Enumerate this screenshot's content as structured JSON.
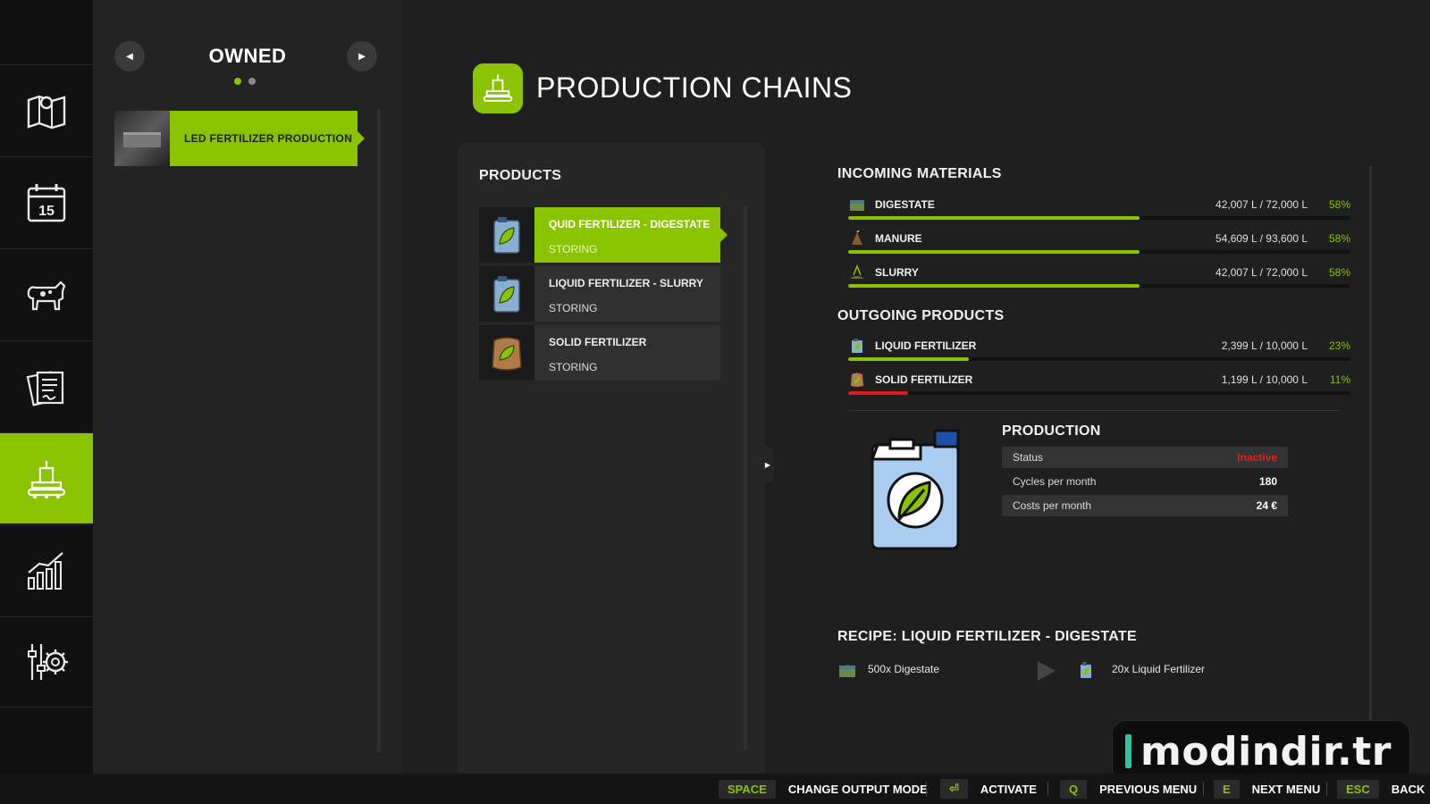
{
  "sidebar": {
    "items": [
      {
        "icon": "map-icon"
      },
      {
        "icon": "calendar-icon",
        "day": "15"
      },
      {
        "icon": "cow-icon"
      },
      {
        "icon": "contracts-icon"
      },
      {
        "icon": "production-icon",
        "active": true
      },
      {
        "icon": "statistics-icon"
      },
      {
        "icon": "settings-icon"
      }
    ]
  },
  "owned": {
    "title": "OWNED",
    "prev_label": "◀",
    "next_label": "▶",
    "page_count": 2,
    "current_page": 1,
    "items": [
      {
        "label": "LED FERTILIZER PRODUCTION"
      }
    ]
  },
  "header": {
    "title": "PRODUCTION CHAINS"
  },
  "products": {
    "title": "PRODUCTS",
    "items": [
      {
        "name": "QUID FERTILIZER - DIGESTATE",
        "status": "STORING",
        "icon": "liquid-fertilizer-icon",
        "active": true
      },
      {
        "name": "LIQUID FERTILIZER - SLURRY",
        "status": "STORING",
        "icon": "liquid-fertilizer-icon"
      },
      {
        "name": "SOLID FERTILIZER",
        "status": "STORING",
        "icon": "solid-fertilizer-icon"
      }
    ]
  },
  "incoming": {
    "title": "INCOMING MATERIALS",
    "items": [
      {
        "name": "DIGESTATE",
        "amount": "42,007 L / 72,000 L",
        "percent": "58%",
        "fill": 0.58,
        "icon": "digestate-icon"
      },
      {
        "name": "MANURE",
        "amount": "54,609 L / 93,600 L",
        "percent": "58%",
        "fill": 0.58,
        "icon": "manure-icon"
      },
      {
        "name": "SLURRY",
        "amount": "42,007 L / 72,000 L",
        "percent": "58%",
        "fill": 0.58,
        "icon": "slurry-icon"
      }
    ]
  },
  "outgoing": {
    "title": "OUTGOING PRODUCTS",
    "items": [
      {
        "name": "LIQUID FERTILIZER",
        "amount": "2,399 L / 10,000 L",
        "percent": "23%",
        "fill": 0.24,
        "icon": "liquid-fertilizer-small-icon"
      },
      {
        "name": "SOLID FERTILIZER",
        "amount": "1,199 L / 10,000 L",
        "percent": "11%",
        "fill": 0.12,
        "icon": "solid-fertilizer-small-icon"
      }
    ]
  },
  "production": {
    "title": "PRODUCTION",
    "rows": [
      {
        "label": "Status",
        "value": "Inactive"
      },
      {
        "label": "Cycles per month",
        "value": "180"
      },
      {
        "label": "Costs per month",
        "value": "24 €"
      }
    ]
  },
  "recipe": {
    "title": "RECIPE: LIQUID FERTILIZER - DIGESTATE",
    "input": "500x Digestate",
    "output": "20x Liquid Fertilizer"
  },
  "footer": {
    "actions": [
      {
        "key": "SPACE",
        "label": "CHANGE OUTPUT MODE"
      },
      {
        "key": "⏎",
        "label": "ACTIVATE"
      },
      {
        "key": "Q",
        "label": "PREVIOUS MENU"
      },
      {
        "key": "E",
        "label": "NEXT MENU"
      },
      {
        "key": "ESC",
        "label": "BACK"
      }
    ]
  },
  "watermark": "modindir.tr",
  "colors": {
    "accent": "#8ac400",
    "bar_green": "#8ac400",
    "bar_red": "#e01a1a",
    "status_inactive": "#e02020"
  }
}
